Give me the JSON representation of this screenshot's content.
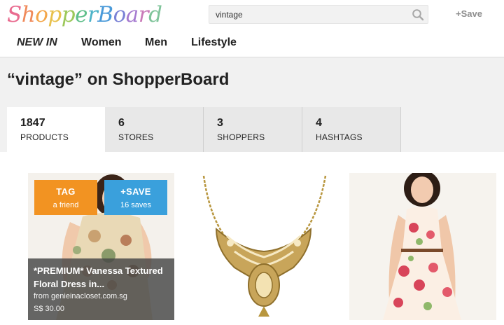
{
  "brand": {
    "logo_text": "ShopperBoard",
    "logo_letters": [
      "S",
      "h",
      "o",
      "p",
      "p",
      "e",
      "r",
      "B",
      "o",
      "a",
      "r",
      "d"
    ],
    "logo_colors": [
      "#e96b8f",
      "#f08a5a",
      "#f3a64a",
      "#e8c14d",
      "#9cc85a",
      "#5fbf8a",
      "#4cb3c8",
      "#4a9ad9",
      "#7b83d6",
      "#a57ad0",
      "#c97ab8",
      "#7fc49a"
    ]
  },
  "search": {
    "value": "vintage",
    "icon": "search-icon"
  },
  "header": {
    "save_label": "+Save"
  },
  "nav": {
    "items": [
      "NEW IN",
      "Women",
      "Men",
      "Lifestyle"
    ]
  },
  "page": {
    "title": "“vintage” on ShopperBoard"
  },
  "tabs": [
    {
      "count": "1847",
      "label": "PRODUCTS"
    },
    {
      "count": "6",
      "label": "STORES"
    },
    {
      "count": "3",
      "label": "SHOPPERS"
    },
    {
      "count": "4",
      "label": "HASHTAGS"
    }
  ],
  "products": [
    {
      "tag_label": "TAG",
      "tag_sub": "a friend",
      "save_label": "+SAVE",
      "save_sub": "16 saves",
      "title": "*PREMIUM* Vanessa Textured Floral Dress in...",
      "store": "from genieinacloset.com.sg",
      "price": "S$ 30.00"
    },
    {
      "image": "gold-lace-necklace"
    },
    {
      "image": "floral-halter-dress"
    }
  ],
  "colors": {
    "tag": "#f29322",
    "save": "#3aa0dc"
  }
}
